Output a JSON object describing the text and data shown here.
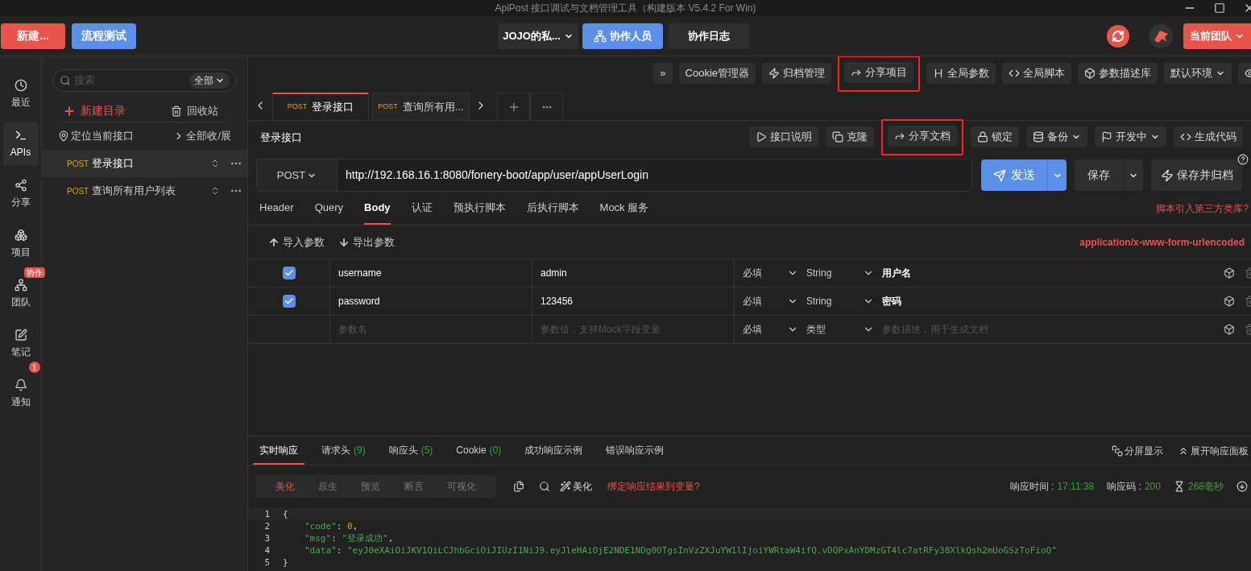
{
  "window": {
    "title": "ApiPost 接口调试与文档管理工具（构建版本 V5.4.2 For Win)"
  },
  "top_bar": {
    "new_button": "新建...",
    "flow_test_button": "流程测试",
    "project_select": "JOJO的私...",
    "collaborators_button": "协作人员",
    "collab_log_button": "协作日志",
    "team_button": "当前团队"
  },
  "nav": [
    {
      "label": "最近",
      "selected": false
    },
    {
      "label": "APIs",
      "selected": true
    },
    {
      "label": "分享",
      "selected": false
    },
    {
      "label": "项目",
      "selected": false
    },
    {
      "label": "团队",
      "selected": false,
      "badge": {
        "kind": "tag",
        "text": "协作"
      }
    },
    {
      "label": "笔记",
      "selected": false
    },
    {
      "label": "通知",
      "selected": false,
      "badge": {
        "kind": "count",
        "text": "1"
      }
    }
  ],
  "sidebar": {
    "search": {
      "placeholder": "搜索"
    },
    "filter": "全部",
    "new_folder": "新建目录",
    "recycle_bin": "回收站",
    "locate": "定位当前接口",
    "collapse_all": "全部收/展",
    "items": [
      {
        "method": "POST",
        "name": "登录接口",
        "selected": true
      },
      {
        "method": "POST",
        "name": "查询所有用户列表",
        "selected": false
      }
    ]
  },
  "toolbar": [
    {
      "label": "»",
      "highlighted": false,
      "dropdown": false
    },
    {
      "label": "Cookie管理器",
      "highlighted": false,
      "dropdown": false
    },
    {
      "label": "归档管理",
      "highlighted": false,
      "dropdown": false
    },
    {
      "label": "分享项目",
      "highlighted": true,
      "dropdown": false
    },
    {
      "label": "全局参数",
      "highlighted": false,
      "dropdown": false
    },
    {
      "label": "全局脚本",
      "highlighted": false,
      "dropdown": false
    },
    {
      "label": "参数描述库",
      "highlighted": false,
      "dropdown": false
    },
    {
      "label": "默认环境",
      "highlighted": false,
      "dropdown": true
    },
    {
      "highlighted": false,
      "dropdown": false
    }
  ],
  "tabs": [
    {
      "method": "POST",
      "name": "登录接口",
      "selected": true
    },
    {
      "method": "POST",
      "name": "查询所有用...",
      "selected": false
    }
  ],
  "request": {
    "title": "登录接口",
    "actions": [
      {
        "label": "接口说明",
        "highlighted": false,
        "dropdown": false
      },
      {
        "label": "克隆",
        "highlighted": false,
        "dropdown": false
      },
      {
        "label": "分享文档",
        "highlighted": true,
        "dropdown": false
      },
      {
        "label": "锁定",
        "highlighted": false,
        "dropdown": false
      },
      {
        "label": "备份",
        "highlighted": false,
        "dropdown": true
      },
      {
        "label": "开发中",
        "highlighted": false,
        "dropdown": true
      },
      {
        "label": "生成代码",
        "highlighted": false,
        "dropdown": false
      }
    ],
    "method": "POST",
    "url": "http://192.168.16.1:8080/fonery-boot/app/user/appUserLogin",
    "send": "发送",
    "save": "保存",
    "save_archive": "保存并归档"
  },
  "body_tabs": [
    {
      "label": "Header",
      "selected": false
    },
    {
      "label": "Query",
      "selected": false
    },
    {
      "label": "Body",
      "selected": true
    },
    {
      "label": "认证",
      "selected": false
    },
    {
      "label": "预执行脚本",
      "selected": false
    },
    {
      "label": "后执行脚本",
      "selected": false
    },
    {
      "label": "Mock 服务",
      "selected": false
    }
  ],
  "script_link": "脚本引入第三方类库?",
  "body": {
    "import": "导入参数",
    "export": "导出参数",
    "content_type": "application/x-www-form-urlencoded",
    "params": [
      {
        "kind": "param",
        "checked": true,
        "name": "username",
        "value": "admin",
        "required": "必填",
        "type": "String",
        "description": "用户名"
      },
      {
        "kind": "param",
        "checked": true,
        "name": "password",
        "value": "123456",
        "required": "必填",
        "type": "String",
        "description": "密码"
      },
      {
        "kind": "new",
        "name": {
          "placeholder": "参数名"
        },
        "value": {
          "placeholder": "参数值，支持Mock字段变量"
        },
        "required": "必填",
        "type": "类型",
        "description": {
          "placeholder": "参数描述，用于生成文档"
        }
      }
    ]
  },
  "response": {
    "tabs": [
      {
        "label": "实时响应",
        "selected": true
      },
      {
        "label": "请求头",
        "count": "(9)",
        "selected": false
      },
      {
        "label": "响应头",
        "count": "(5)",
        "selected": false
      },
      {
        "label": "Cookie",
        "count": "(0)",
        "selected": false
      },
      {
        "label": "成功响应示例",
        "selected": false
      },
      {
        "label": "错误响应示例",
        "selected": false
      }
    ],
    "split_view": "分屏显示",
    "expand_panel": "展开响应面板",
    "views": [
      {
        "label": "美化",
        "selected": true
      },
      {
        "label": "原生",
        "selected": false
      },
      {
        "label": "预览",
        "selected": false
      },
      {
        "label": "断言",
        "selected": false
      },
      {
        "label": "可视化",
        "selected": false
      }
    ],
    "beautify": "美化",
    "bind_link": "绑定响应结果到变量?",
    "stats": [
      {
        "kind": "labeled",
        "label": "响应时间 :",
        "value": "17:11:38"
      },
      {
        "kind": "labeled",
        "label": "响应码 :",
        "value": "200"
      },
      {
        "kind": "duration",
        "value": "268毫秒"
      }
    ],
    "code": [
      {
        "number": "1",
        "indented": false,
        "tokens": [
          {
            "kind": "punct",
            "text": "{"
          }
        ]
      },
      {
        "number": "2",
        "indented": true,
        "tokens": [
          {
            "kind": "key",
            "text": "\"code\""
          },
          {
            "kind": "punct",
            "text": ": "
          },
          {
            "kind": "number",
            "text": "0"
          },
          {
            "kind": "punct",
            "text": ","
          }
        ]
      },
      {
        "number": "3",
        "indented": true,
        "tokens": [
          {
            "kind": "key",
            "text": "\"msg\""
          },
          {
            "kind": "punct",
            "text": ": "
          },
          {
            "kind": "string",
            "text": "\"登录成功\""
          },
          {
            "kind": "punct",
            "text": ","
          }
        ]
      },
      {
        "number": "4",
        "indented": true,
        "tokens": [
          {
            "kind": "key",
            "text": "\"data\""
          },
          {
            "kind": "punct",
            "text": ": "
          },
          {
            "kind": "string",
            "text": "\"eyJ0eXAiOiJKV1QiLCJhbGciOiJIUzI1NiJ9.eyJleHAiOjE2NDE1NDg0OTgsInVzZXJuYW1lIjoiYWRtaW4ifQ.vDQPxAnYDMzGT4lc7atRFy38XlkQsh2mUoGSzToFioQ\""
          }
        ]
      },
      {
        "number": "5",
        "indented": false,
        "tokens": [
          {
            "kind": "punct",
            "text": "}"
          }
        ]
      }
    ]
  }
}
